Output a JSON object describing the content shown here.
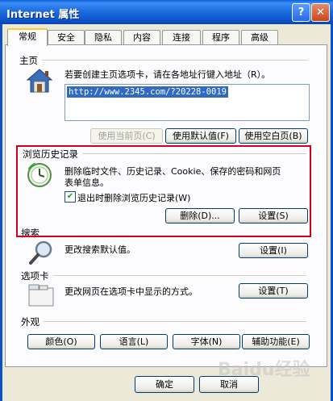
{
  "window": {
    "title": "Internet 属性",
    "help": "?",
    "close": "✕"
  },
  "tabs": [
    "常规",
    "安全",
    "隐私",
    "内容",
    "连接",
    "程序",
    "高级"
  ],
  "home": {
    "title": "主页",
    "desc": "若要创建主页选项卡，请在各地址行键入地址（R）。",
    "url": "http://www.2345.com/?20228-0019",
    "buttons": {
      "current": "使用当前页(C)",
      "default": "使用默认值(F)",
      "blank": "使用空白页(B)"
    }
  },
  "history": {
    "title": "浏览历史记录",
    "desc_line1": "删除临时文件、历史记录、Cookie、保存的密码和网页",
    "desc_line2": "表单信息。",
    "checkbox_label": "退出时删除浏览历史记录(W)",
    "checkbox_checked": true,
    "check_mark": "✔",
    "delete_button": "删除(D)...",
    "settings_button": "设置(S)"
  },
  "search": {
    "title": "搜索",
    "desc": "更改搜索默认值。",
    "settings_button": "设置(I)"
  },
  "tabs_section": {
    "title": "选项卡",
    "desc": "更改网页在选项卡中显示的方式。",
    "settings_button": "设置(T)"
  },
  "appearance": {
    "title": "外观",
    "buttons": {
      "colors": "颜色(O)",
      "languages": "语言(L)",
      "fonts": "字体(N)",
      "accessibility": "辅助功能(E)"
    }
  },
  "footer": {
    "ok": "确定",
    "cancel": "取消"
  },
  "watermark": "Baidu经验",
  "icons": {
    "home": "house-icon",
    "history": "history-clock-icon",
    "search": "magnifier-icon",
    "tabs": "tabbed-window-icon"
  },
  "colors": {
    "titlebar": "#0a5fd8",
    "highlight_box": "#d2001e",
    "url_selection": "#316ac5"
  }
}
